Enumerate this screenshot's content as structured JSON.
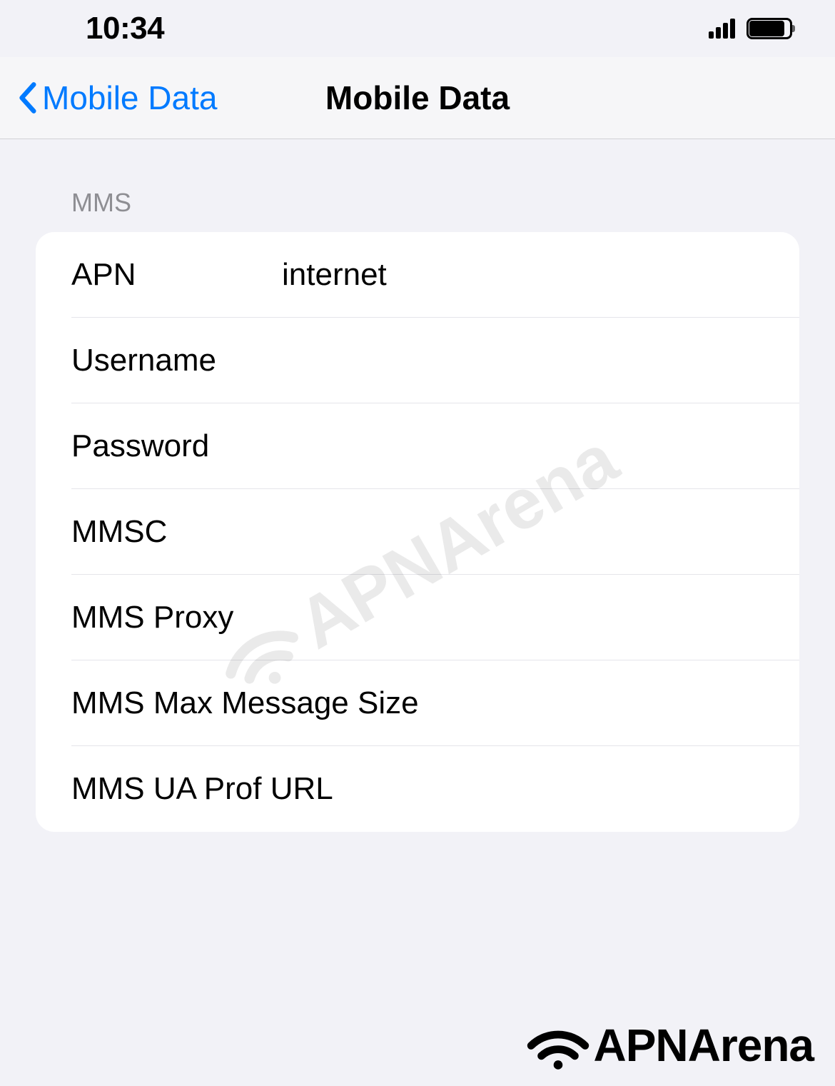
{
  "status": {
    "time": "10:34"
  },
  "nav": {
    "back_label": "Mobile Data",
    "title": "Mobile Data"
  },
  "section": {
    "header": "MMS"
  },
  "fields": {
    "apn": {
      "label": "APN",
      "value": "internet"
    },
    "username": {
      "label": "Username",
      "value": ""
    },
    "password": {
      "label": "Password",
      "value": ""
    },
    "mmsc": {
      "label": "MMSC",
      "value": ""
    },
    "mms_proxy": {
      "label": "MMS Proxy",
      "value": ""
    },
    "mms_max_size": {
      "label": "MMS Max Message Size",
      "value": ""
    },
    "mms_ua_prof": {
      "label": "MMS UA Prof URL",
      "value": ""
    }
  },
  "brand": {
    "watermark": "APNArena",
    "footer": "APNArena"
  }
}
